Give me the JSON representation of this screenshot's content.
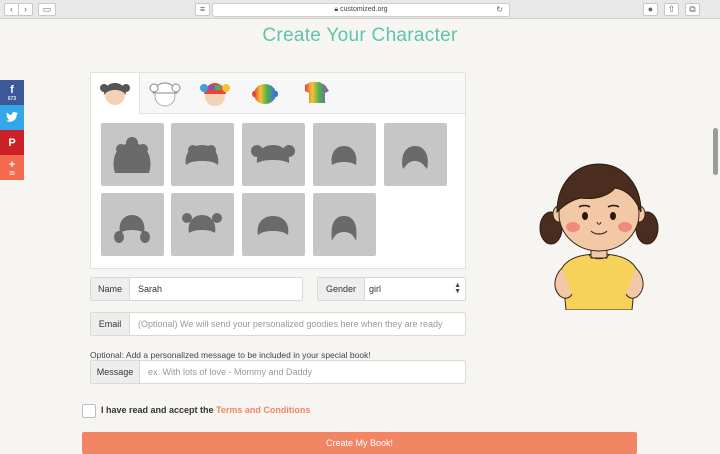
{
  "browser": {
    "url": "customized.org",
    "lock_icon": "lock-icon"
  },
  "social": [
    {
      "name": "facebook",
      "glyph": "f",
      "count": "673"
    },
    {
      "name": "twitter",
      "glyph": "",
      "count": ""
    },
    {
      "name": "pinterest",
      "glyph": "P",
      "count": ""
    },
    {
      "name": "more",
      "glyph": "+",
      "count": "35"
    }
  ],
  "page": {
    "title": "Create Your Character"
  },
  "customizer": {
    "tabs": [
      "hair-tab",
      "hat-tab",
      "hair-color-tab",
      "skin-tab",
      "shirt-tab"
    ],
    "hairstyles_count": 9
  },
  "form": {
    "name_label": "Name",
    "name_value": "Sarah",
    "gender_label": "Gender",
    "gender_value": "girl",
    "email_label": "Email",
    "email_placeholder": "(Optional) We will send your personalized goodies here when they are ready",
    "message_note": "Optional: Add a personalized message to be included in your special book!",
    "message_label": "Message",
    "message_placeholder": "ex. With lots of love - Mommy and Daddy",
    "agree_prefix": "I have read and accept the ",
    "agree_link": "Terms and Conditions",
    "submit_label": "Create My Book!"
  },
  "colors": {
    "title": "#5cc3b2",
    "accent": "#f28563",
    "facebook": "#3b5998",
    "twitter": "#33a7ea",
    "pinterest": "#cb2127"
  }
}
